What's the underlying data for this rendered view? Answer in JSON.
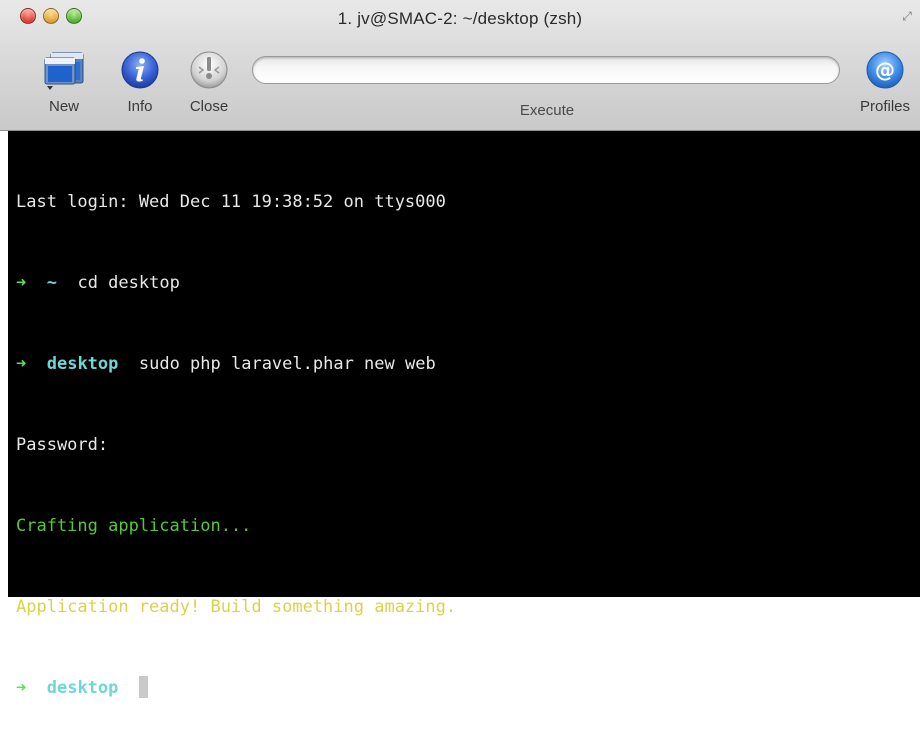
{
  "window": {
    "title": "1. jv@SMAC-2: ~/desktop (zsh)"
  },
  "toolbar": {
    "new_label": "New",
    "info_label": "Info",
    "close_label": "Close",
    "execute_label": "Execute",
    "execute_value": "",
    "profiles_label": "Profiles"
  },
  "terminal": {
    "last_login": "Last login: Wed Dec 11 19:38:52 on ttys000",
    "prompt_arrow": "➜",
    "line2_dir": "~",
    "line2_cmd": "cd desktop",
    "line3_dir": "desktop",
    "line3_cmd": "sudo php laravel.phar new web",
    "password": "Password:",
    "crafting": "Crafting application...",
    "ready": "Application ready! Build something amazing.",
    "line8_dir": "desktop"
  },
  "colors": {
    "arrow": "#5ce05c",
    "directory": "#6fd6d6",
    "crafting": "#54c83a",
    "ready": "#d8d44a",
    "text": "#e8e8e8",
    "background": "#000000"
  }
}
